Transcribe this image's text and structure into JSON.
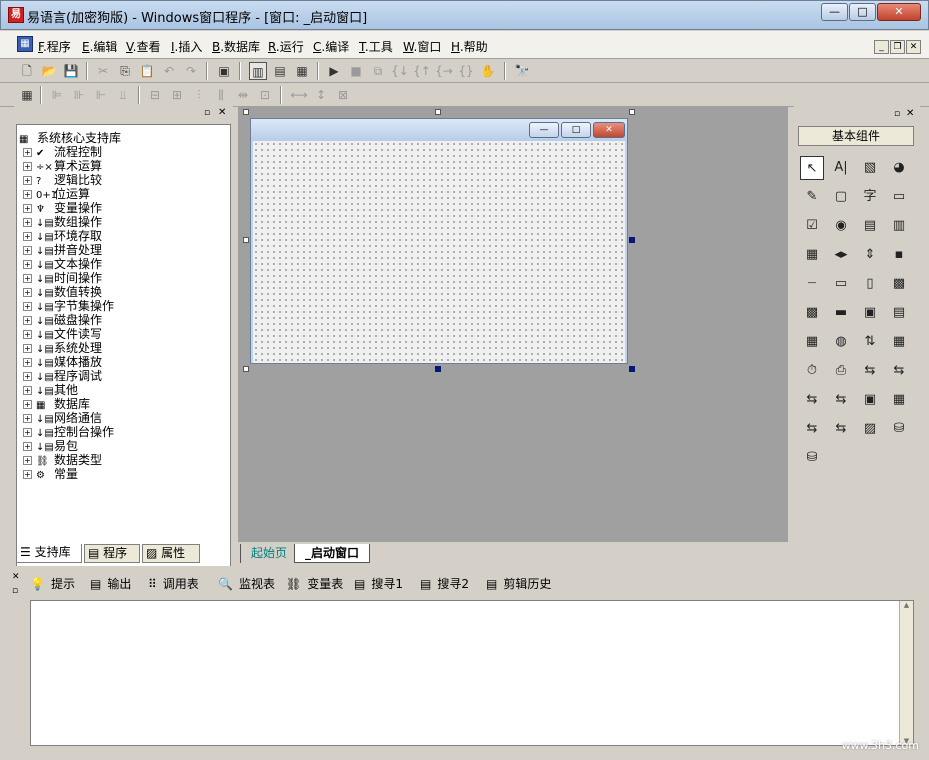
{
  "window": {
    "title": "易语言(加密狗版) - Windows窗口程序 - [窗口: _启动窗口]",
    "app_icon": "易",
    "caption_buttons": {
      "minimize": "—",
      "maximize": "□",
      "close": "✕"
    }
  },
  "menu": {
    "items": [
      {
        "key": "F",
        "label": ".程序"
      },
      {
        "key": "E",
        "label": ".编辑"
      },
      {
        "key": "V",
        "label": ".查看"
      },
      {
        "key": "I",
        "label": ".插入"
      },
      {
        "key": "B",
        "label": ".数据库"
      },
      {
        "key": "R",
        "label": ".运行"
      },
      {
        "key": "C",
        "label": ".编译"
      },
      {
        "key": "T",
        "label": ".工具"
      },
      {
        "key": "W",
        "label": ".窗口"
      },
      {
        "key": "H",
        "label": ".帮助"
      }
    ],
    "mdi_buttons": {
      "minimize": "_",
      "restore": "❐",
      "close": "✕"
    }
  },
  "toolbar1": {
    "icons": [
      "new-icon",
      "open-icon",
      "save-icon",
      "cut-icon",
      "copy-icon",
      "paste-icon",
      "undo-icon",
      "redo-icon",
      "find-icon",
      "layout1-icon",
      "layout2-icon",
      "layout3-icon",
      "run-icon",
      "stop-icon",
      "step1-icon",
      "step2-icon",
      "step3-icon",
      "step4-icon",
      "step5-icon",
      "hand-icon",
      "debug-icon"
    ]
  },
  "toolbar2": {
    "icons": [
      "align-icon"
    ]
  },
  "left_panel": {
    "root": "系统核心支持库",
    "nodes": [
      {
        "icon": "✔",
        "label": "流程控制"
      },
      {
        "icon": "÷×",
        "label": "算术运算"
      },
      {
        "icon": "?",
        "label": "逻辑比较"
      },
      {
        "icon": "0+1",
        "label": "位运算"
      },
      {
        "icon": "♆",
        "label": "变量操作"
      },
      {
        "icon": "↓▤",
        "label": "数组操作"
      },
      {
        "icon": "↓▤",
        "label": "环境存取"
      },
      {
        "icon": "↓▤",
        "label": "拼音处理"
      },
      {
        "icon": "↓▤",
        "label": "文本操作"
      },
      {
        "icon": "↓▤",
        "label": "时间操作"
      },
      {
        "icon": "↓▤",
        "label": "数值转换"
      },
      {
        "icon": "↓▤",
        "label": "字节集操作"
      },
      {
        "icon": "↓▤",
        "label": "磁盘操作"
      },
      {
        "icon": "↓▤",
        "label": "文件读写"
      },
      {
        "icon": "↓▤",
        "label": "系统处理"
      },
      {
        "icon": "↓▤",
        "label": "媒体播放"
      },
      {
        "icon": "↓▤",
        "label": "程序调试"
      },
      {
        "icon": "↓▤",
        "label": "其他"
      },
      {
        "icon": "▦",
        "label": "数据库"
      },
      {
        "icon": "↓▤",
        "label": "网络通信"
      },
      {
        "icon": "↓▤",
        "label": "控制台操作"
      },
      {
        "icon": "↓▤",
        "label": "易包"
      },
      {
        "icon": "⛓",
        "label": "数据类型"
      },
      {
        "icon": "⚙",
        "label": "常量"
      }
    ],
    "tabs": [
      {
        "label": "支持库",
        "icon": "☰"
      },
      {
        "label": "程序",
        "icon": "▤"
      },
      {
        "label": "属性",
        "icon": "▨"
      }
    ]
  },
  "designer": {
    "form_caption": "",
    "doc_tabs": [
      "起始页",
      "_启动窗口"
    ]
  },
  "right_panel": {
    "title": "基本组件",
    "components": [
      "↖",
      "A|",
      "▧",
      "◕",
      "✎",
      "▢",
      "字",
      "▭",
      "☑",
      "◉",
      "▤",
      "▥",
      "▦",
      "◂▸",
      "⇕",
      "▪",
      "┈",
      "▭",
      "▯",
      "▩",
      "▩",
      "▬",
      "▣",
      "▤",
      "▦",
      "◍",
      "⇅",
      "▦",
      "⏱",
      "⎙",
      "⇆",
      "⇆",
      "⇆",
      "⇆",
      "▣",
      "▦",
      "⇆",
      "⇆",
      "▨",
      "⛁",
      "⛁"
    ]
  },
  "bottom_panel": {
    "tabs": [
      {
        "icon": "💡",
        "label": "提示"
      },
      {
        "icon": "▤",
        "label": "输出"
      },
      {
        "icon": "⠿",
        "label": "调用表"
      },
      {
        "icon": "🔍",
        "label": "监视表"
      },
      {
        "icon": "⛓",
        "label": "变量表"
      },
      {
        "icon": "▤",
        "label": "搜寻1"
      },
      {
        "icon": "▤",
        "label": "搜寻2"
      },
      {
        "icon": "▤",
        "label": "剪辑历史"
      }
    ],
    "watermark": "www.3h3.com"
  }
}
